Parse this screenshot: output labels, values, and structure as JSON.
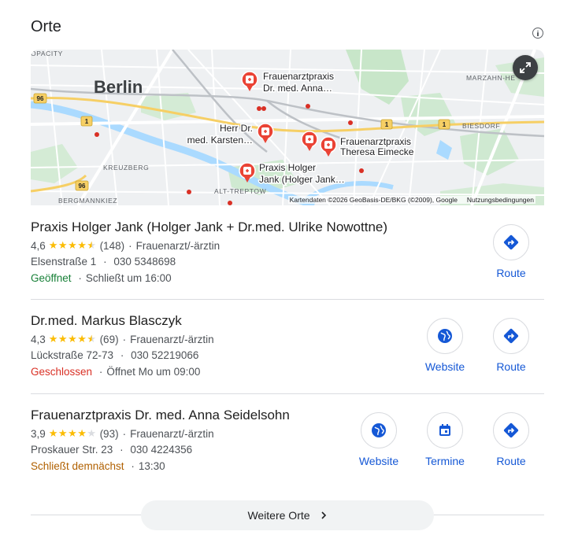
{
  "header": {
    "title": "Orte",
    "info_icon": "info-icon"
  },
  "map": {
    "city_label": "Berlin",
    "district_labels": [
      "OPACITY",
      "BERGMANNKIEZ",
      "KREUZBERG",
      "ALT-TREPTOW",
      "MARZAHN-HE",
      "BIESDORF"
    ],
    "road_shields": [
      "96",
      "1",
      "96",
      "1",
      "1"
    ],
    "pins": [
      {
        "label_lines": [
          "Frauenarztpraxis",
          "Dr. med. Anna…"
        ]
      },
      {
        "label_lines": [
          "Herr Dr.",
          "med. Karsten…"
        ]
      },
      {
        "label_lines": [
          "Frauenarztpraxis",
          "Theresa Eimecke"
        ]
      },
      {
        "label_lines": [
          "Praxis Holger",
          "Jank (Holger Jank…"
        ]
      }
    ],
    "attribution": "Kartendaten ©2026 GeoBasis-DE/BKG (©2009), Google",
    "terms": "Nutzungsbedingungen",
    "expand_icon": "expand-icon"
  },
  "results": [
    {
      "name": "Praxis Holger Jank (Holger Jank + Dr.med. Ulrike Nowottne)",
      "rating": "4,6",
      "stars": 4.5,
      "reviews": "(148)",
      "category": "Frauenarzt/-ärztin",
      "address": "Elsenstraße 1",
      "phone": "030 5348698",
      "status": "Geöffnet",
      "status_kind": "open",
      "status_detail": "Schließt um 16:00",
      "actions": [
        "Route"
      ]
    },
    {
      "name": "Dr.med. Markus Blasczyk",
      "rating": "4,3",
      "stars": 4.5,
      "reviews": "(69)",
      "category": "Frauenarzt/-ärztin",
      "address": "Lückstraße 72-73",
      "phone": "030 52219066",
      "status": "Geschlossen",
      "status_kind": "closed",
      "status_detail": "Öffnet Mo um 09:00",
      "actions": [
        "Website",
        "Route"
      ]
    },
    {
      "name": "Frauenarztpraxis Dr. med. Anna Seidelsohn",
      "rating": "3,9",
      "stars": 4,
      "reviews": "(93)",
      "category": "Frauenarzt/-ärztin",
      "address": "Proskauer Str. 23",
      "phone": "030 4224356",
      "status": "Schließt demnächst",
      "status_kind": "soon",
      "status_detail": "13:30",
      "actions": [
        "Website",
        "Termine",
        "Route"
      ]
    }
  ],
  "separator": "·",
  "more": {
    "label": "Weitere Orte",
    "icon": "chevron-right-icon"
  },
  "colors": {
    "link_blue": "#1558d6",
    "star": "#fbbc04",
    "open": "#188038",
    "closed": "#d93025",
    "soon": "#b06000",
    "pin_red": "#ea4335"
  }
}
